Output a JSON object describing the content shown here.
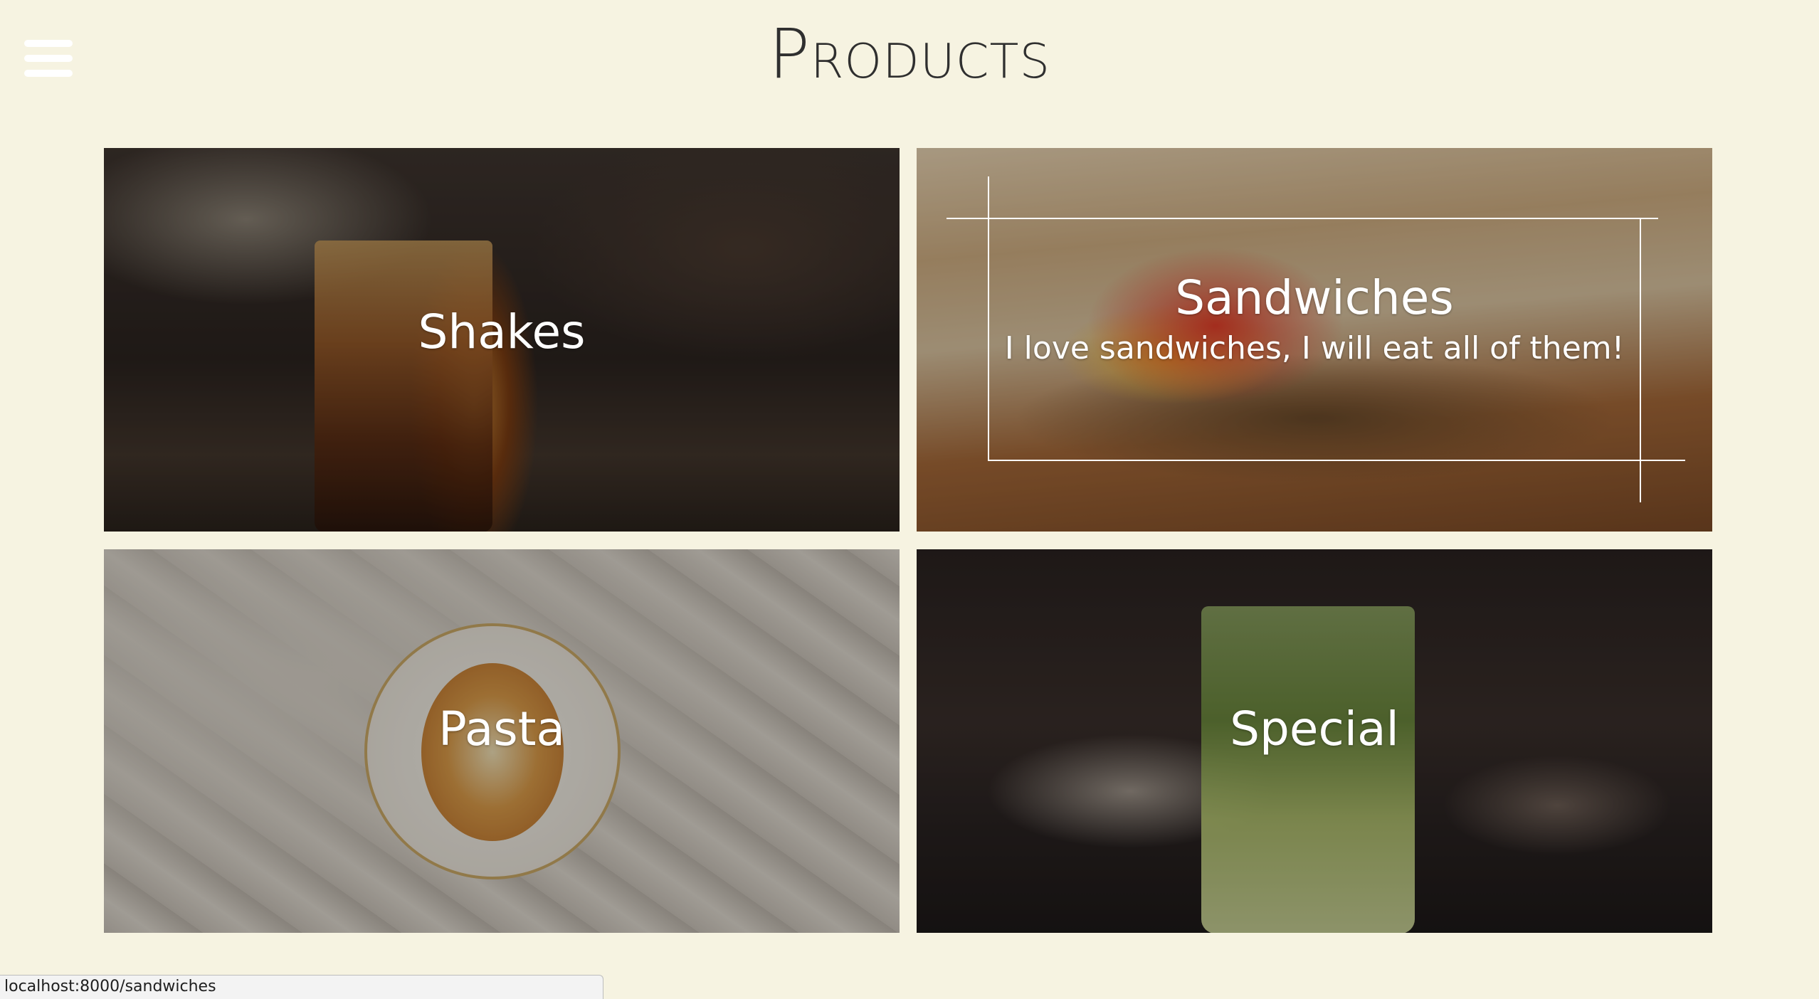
{
  "header": {
    "title": "Products",
    "menu_icon": "hamburger-menu-icon"
  },
  "tiles": [
    {
      "label": "Shakes",
      "subtitle": ""
    },
    {
      "label": "Sandwiches",
      "subtitle": "I love sandwiches, I will eat all of them!"
    },
    {
      "label": "Pasta",
      "subtitle": ""
    },
    {
      "label": "Special",
      "subtitle": ""
    }
  ],
  "status_bar": {
    "url": "localhost:8000/sandwiches"
  },
  "colors": {
    "page_background": "#f6f3e1",
    "title_text": "#2f2f2f",
    "tile_text": "#ffffff"
  }
}
